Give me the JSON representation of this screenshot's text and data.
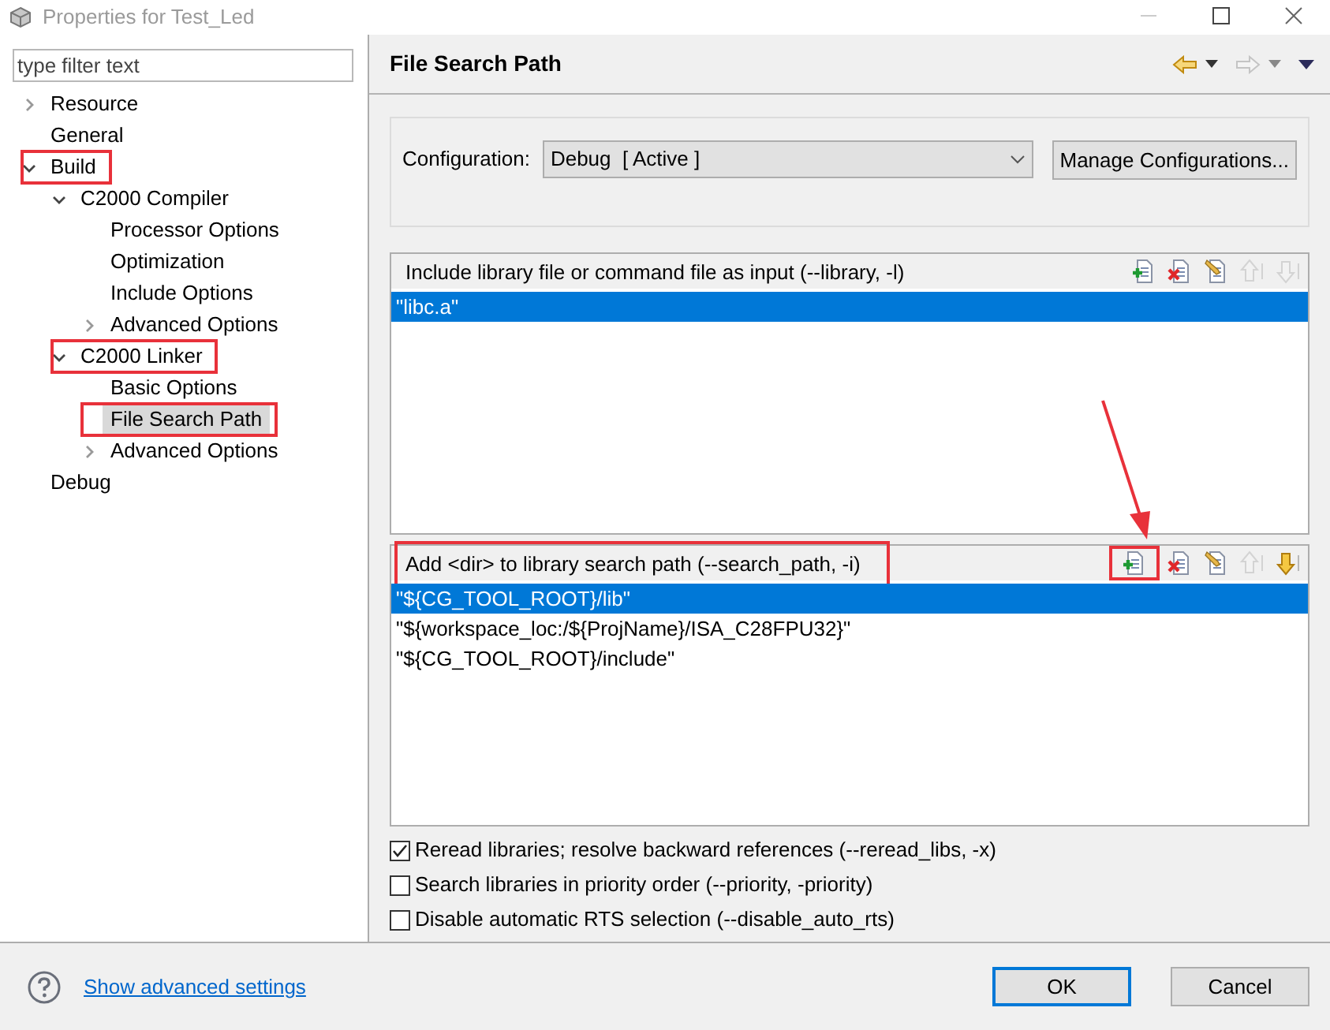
{
  "window": {
    "title": "Properties for Test_Led"
  },
  "filter": {
    "placeholder": "type filter text"
  },
  "tree": [
    {
      "label": "Resource",
      "expanded": false,
      "selected": false,
      "highlighted": false
    },
    {
      "label": "General",
      "selected": false,
      "highlighted": false
    },
    {
      "label": "Build",
      "expanded": true,
      "selected": false,
      "highlighted": true,
      "children": [
        {
          "label": "C2000 Compiler",
          "expanded": true,
          "selected": false,
          "highlighted": false,
          "children": [
            {
              "label": "Processor Options",
              "selected": false,
              "highlighted": false
            },
            {
              "label": "Optimization",
              "selected": false,
              "highlighted": false
            },
            {
              "label": "Include Options",
              "selected": false,
              "highlighted": false
            },
            {
              "label": "Advanced Options",
              "expanded": false,
              "selected": false,
              "highlighted": false
            }
          ]
        },
        {
          "label": "C2000 Linker",
          "expanded": true,
          "selected": false,
          "highlighted": true,
          "children": [
            {
              "label": "Basic Options",
              "selected": false,
              "highlighted": false
            },
            {
              "label": "File Search Path",
              "selected": true,
              "highlighted": true
            },
            {
              "label": "Advanced Options",
              "expanded": false,
              "selected": false,
              "highlighted": false
            }
          ]
        }
      ]
    },
    {
      "label": "Debug",
      "selected": false,
      "highlighted": false
    }
  ],
  "page": {
    "title": "File Search Path"
  },
  "configuration": {
    "label": "Configuration:",
    "value": "Debug  [ Active ]",
    "button": "Manage Configurations..."
  },
  "lists": [
    {
      "title": "Include library file or command file as input (--library, -l)",
      "highlighted": false,
      "tools": [
        {
          "kind": "add",
          "disabled": false,
          "highlighted": false
        },
        {
          "kind": "delete",
          "disabled": false,
          "highlighted": false
        },
        {
          "kind": "edit",
          "disabled": false,
          "highlighted": false
        },
        {
          "kind": "up",
          "disabled": true,
          "highlighted": false
        },
        {
          "kind": "down",
          "disabled": true,
          "highlighted": false
        }
      ],
      "rows": [
        {
          "text": "\"libc.a\"",
          "selected": true
        }
      ]
    },
    {
      "title": "Add <dir> to library search path (--search_path, -i)",
      "highlighted": true,
      "tools": [
        {
          "kind": "add",
          "disabled": false,
          "highlighted": true
        },
        {
          "kind": "delete",
          "disabled": false,
          "highlighted": false
        },
        {
          "kind": "edit",
          "disabled": false,
          "highlighted": false
        },
        {
          "kind": "up",
          "disabled": true,
          "highlighted": false
        },
        {
          "kind": "down",
          "disabled": false,
          "highlighted": false
        }
      ],
      "rows": [
        {
          "text": "\"${CG_TOOL_ROOT}/lib\"",
          "selected": true
        },
        {
          "text": "\"${workspace_loc:/${ProjName}/ISA_C28FPU32}\"",
          "selected": false
        },
        {
          "text": "\"${CG_TOOL_ROOT}/include\"",
          "selected": false
        }
      ]
    }
  ],
  "options": [
    {
      "label": "Reread libraries; resolve backward references (--reread_libs, -x)",
      "checked": true
    },
    {
      "label": "Search libraries in priority order (--priority, -priority)",
      "checked": false
    },
    {
      "label": "Disable automatic RTS selection (--disable_auto_rts)",
      "checked": false
    }
  ],
  "footer": {
    "link": "Show advanced settings",
    "buttons": [
      {
        "label": "OK",
        "default": true
      },
      {
        "label": "Cancel",
        "default": false
      }
    ]
  }
}
